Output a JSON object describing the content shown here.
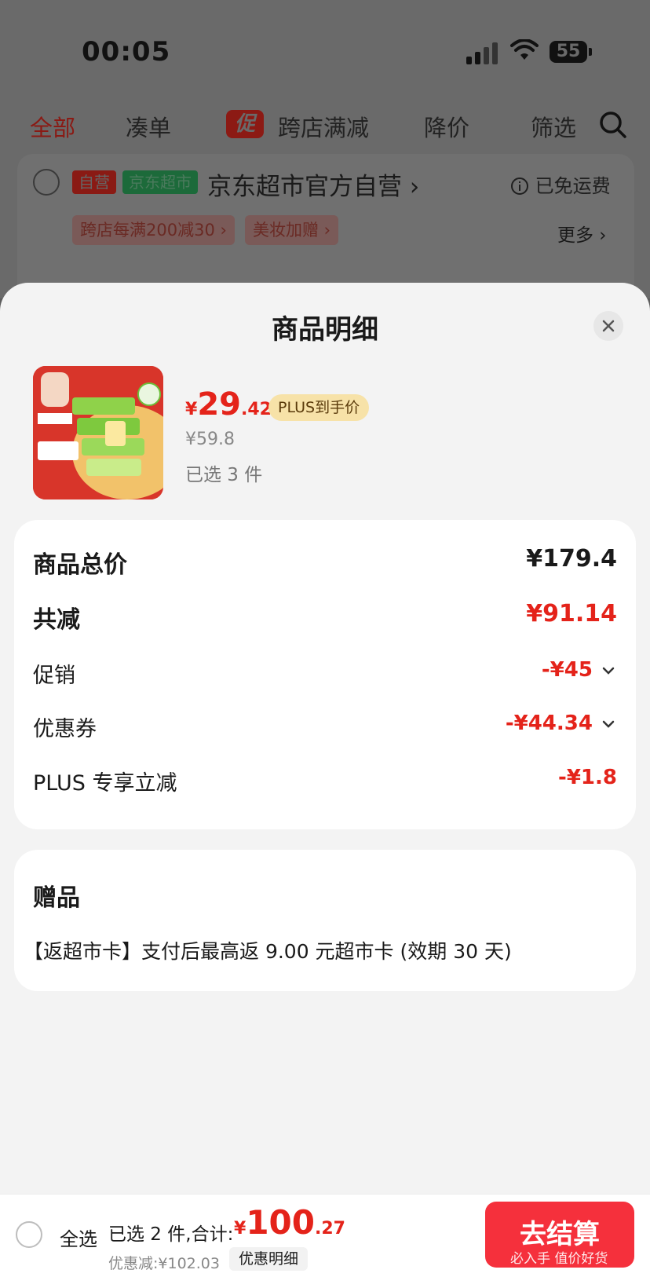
{
  "status_bar": {
    "time": "00:05",
    "battery": "55"
  },
  "tabs": [
    {
      "label": "全部"
    },
    {
      "label": "凑单"
    },
    {
      "label": "跨店满减"
    },
    {
      "label": "降价"
    },
    {
      "label": "筛选"
    }
  ],
  "promo_badge": "促",
  "store": {
    "tag_self": "自营",
    "tag_supermarket": "京东超市",
    "name": "京东超市官方自营 ›",
    "shipping": "已免运费",
    "promo_chips": [
      "跨店每满200减30 ›",
      "美妆加赠 ›"
    ],
    "more": "更多 ›"
  },
  "sheet": {
    "title": "商品明细",
    "product": {
      "price_symbol": "¥",
      "price_int": "29",
      "price_dec": ".42",
      "plus_tag": "PLUS到手价",
      "original_price": "¥59.8",
      "selected_qty": "已选 3 件"
    },
    "breakdown": {
      "total_label": "商品总价",
      "total_value": "¥179.4",
      "reduce_label": "共减",
      "reduce_value": "¥91.14",
      "promo_label": "促销",
      "promo_value": "-¥45",
      "coupon_label": "优惠券",
      "coupon_value": "-¥44.34",
      "plus_label": "PLUS 专享立减",
      "plus_value": "-¥1.8"
    },
    "gift": {
      "title": "赠品",
      "desc": "【返超市卡】支付后最高返 9.00 元超市卡 (效期 30 天)"
    }
  },
  "bottom_bar": {
    "select_all": "全选",
    "summary": "已选 2 件,合计:",
    "total_symbol": "¥",
    "total_int": "100",
    "total_dec": ".27",
    "discount": "优惠减:¥102.03",
    "detail_button": "优惠明细",
    "checkout": "去结算",
    "watermark": "必入手 值价好货"
  },
  "colors": {
    "accent_red": "#e4231a",
    "plus_gold": "#f7e2a8",
    "checkout_red": "#f5303c"
  }
}
